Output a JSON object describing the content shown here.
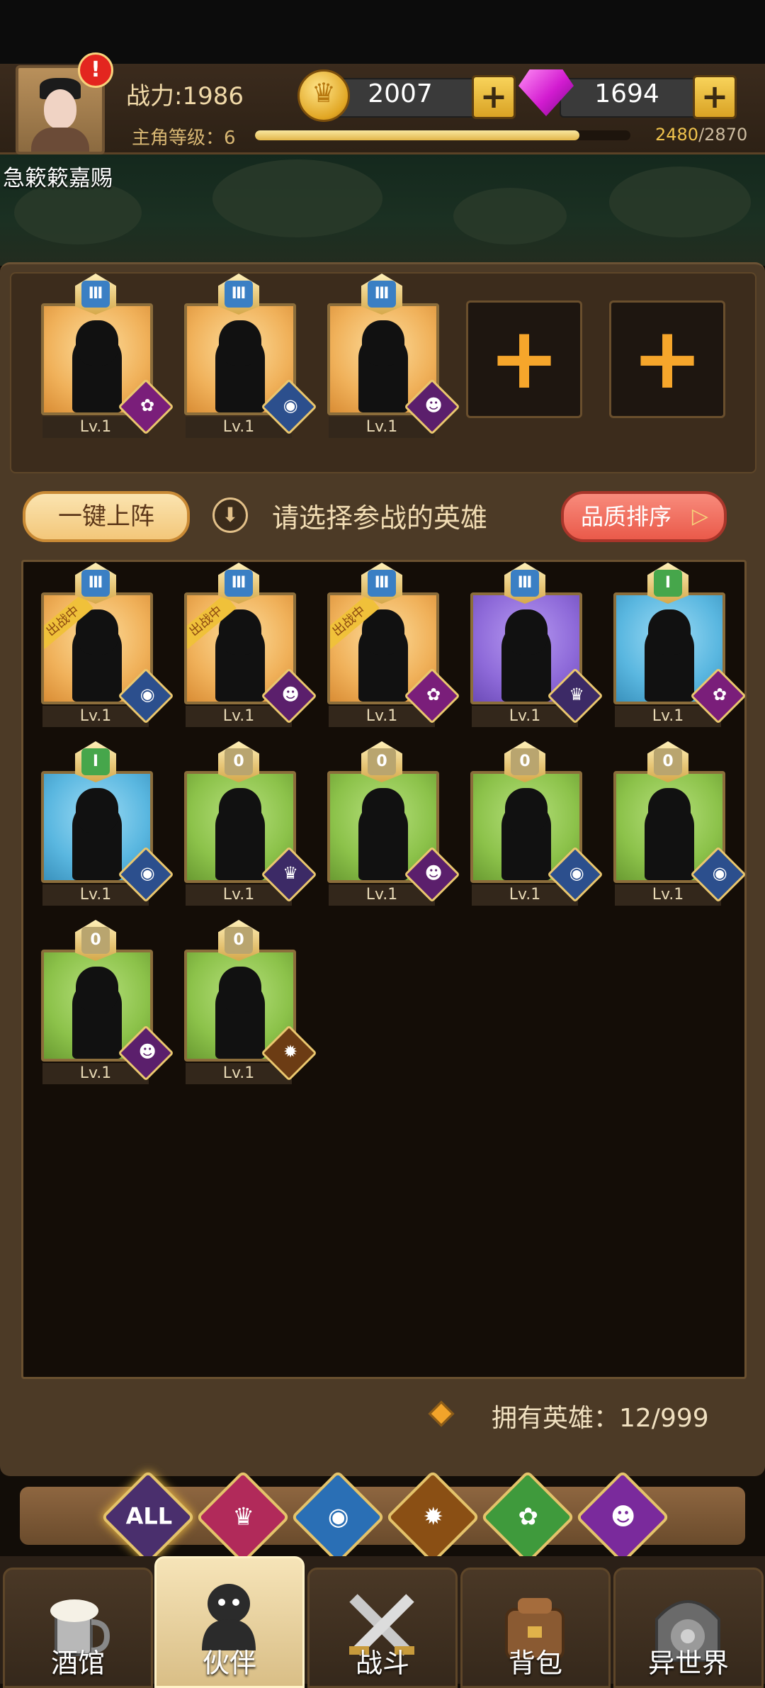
{
  "header": {
    "power_label": "战力:1986",
    "level_label": "主角等级：6",
    "xp_current": "2480",
    "xp_max": "/2870",
    "xp_fraction": 0.864,
    "gold": "2007",
    "gems": "1694",
    "plus": "+",
    "alert": "!"
  },
  "notice": "急簌簌嘉赐",
  "team": {
    "slots": [
      {
        "lv": "Lv.1",
        "rank": "III",
        "bg": "orange",
        "faction": "elf-icon",
        "glyph": "✿"
      },
      {
        "lv": "Lv.1",
        "rank": "III",
        "bg": "orange",
        "faction": "fish-icon",
        "glyph": "◉"
      },
      {
        "lv": "Lv.1",
        "rank": "III",
        "bg": "orange",
        "faction": "demon-icon",
        "glyph": "☻"
      }
    ],
    "empty_plus": "+"
  },
  "actions": {
    "deploy_all": "一键上阵",
    "hint": "请选择参战的英雄",
    "sort": "品质排序",
    "sort_arrow": "▷",
    "down_arrow": "⬇"
  },
  "heroes": {
    "deployed_label": "出战中",
    "rows": [
      [
        {
          "lv": "Lv.1",
          "rank": "III",
          "bg": "orange",
          "deployed": true,
          "faction": "fish-icon",
          "glyph": "◉"
        },
        {
          "lv": "Lv.1",
          "rank": "III",
          "bg": "orange",
          "deployed": true,
          "faction": "demon-icon",
          "glyph": "☻"
        },
        {
          "lv": "Lv.1",
          "rank": "III",
          "bg": "orange",
          "deployed": true,
          "faction": "elf-icon",
          "glyph": "✿"
        },
        {
          "lv": "Lv.1",
          "rank": "III",
          "bg": "purple",
          "deployed": false,
          "faction": "crown-icon",
          "glyph": "♛"
        },
        {
          "lv": "Lv.1",
          "rank": "I",
          "bg": "blue",
          "deployed": false,
          "faction": "elf-icon",
          "glyph": "✿"
        }
      ],
      [
        {
          "lv": "Lv.1",
          "rank": "I",
          "bg": "blue",
          "deployed": false,
          "faction": "fish-icon",
          "glyph": "◉"
        },
        {
          "lv": "Lv.1",
          "rank": "0",
          "bg": "green",
          "deployed": false,
          "faction": "crown-icon",
          "glyph": "♛"
        },
        {
          "lv": "Lv.1",
          "rank": "0",
          "bg": "green",
          "deployed": false,
          "faction": "demon-icon",
          "glyph": "☻"
        },
        {
          "lv": "Lv.1",
          "rank": "0",
          "bg": "green",
          "deployed": false,
          "faction": "fish-icon",
          "glyph": "◉"
        },
        {
          "lv": "Lv.1",
          "rank": "0",
          "bg": "green",
          "deployed": false,
          "faction": "fish-icon",
          "glyph": "◉"
        }
      ],
      [
        {
          "lv": "Lv.1",
          "rank": "0",
          "bg": "green",
          "deployed": false,
          "faction": "demon-icon",
          "glyph": "☻"
        },
        {
          "lv": "Lv.1",
          "rank": "0",
          "bg": "green",
          "deployed": false,
          "faction": "lion-icon",
          "glyph": "✹"
        }
      ]
    ],
    "rank_text": {
      "III": "Ⅲ",
      "I": "Ⅰ",
      "0": "0"
    }
  },
  "owned": "拥有英雄：12/999",
  "filters": [
    {
      "name": "filter-all",
      "label": "ALL"
    },
    {
      "name": "filter-crown-icon",
      "label": "♛"
    },
    {
      "name": "filter-fish-icon",
      "label": "◉"
    },
    {
      "name": "filter-lion-icon",
      "label": "✹"
    },
    {
      "name": "filter-elf-icon",
      "label": "✿"
    },
    {
      "name": "filter-demon-icon",
      "label": "☻"
    }
  ],
  "nav": [
    {
      "name": "tavern",
      "label": "酒馆",
      "active": false
    },
    {
      "name": "partners",
      "label": "伙伴",
      "active": true
    },
    {
      "name": "battle",
      "label": "战斗",
      "active": false
    },
    {
      "name": "backpack",
      "label": "背包",
      "active": false
    },
    {
      "name": "other-world",
      "label": "异世界",
      "active": false
    }
  ]
}
